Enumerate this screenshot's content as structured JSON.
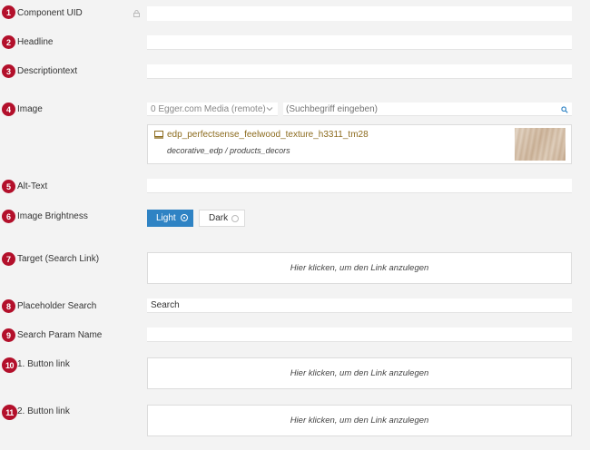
{
  "fields": [
    {
      "num": "1",
      "label": "Component UID"
    },
    {
      "num": "2",
      "label": "Headline"
    },
    {
      "num": "3",
      "label": "Descriptiontext"
    },
    {
      "num": "4",
      "label": "Image"
    },
    {
      "num": "5",
      "label": "Alt-Text"
    },
    {
      "num": "6",
      "label": "Image Brightness"
    },
    {
      "num": "7",
      "label": "Target (Search Link)"
    },
    {
      "num": "8",
      "label": "Placeholder Search"
    },
    {
      "num": "9",
      "label": "Search Param Name"
    },
    {
      "num": "10",
      "label": "1. Button link"
    },
    {
      "num": "11",
      "label": "2. Button link"
    }
  ],
  "image": {
    "source_select": "0 Egger.com Media (remote)",
    "search_placeholder": "(Suchbegriff eingeben)",
    "media_title": "edp_perfectsense_feelwood_texture_h3311_tm28",
    "media_path": "decorative_edp / products_decors"
  },
  "brightness": {
    "light": "Light",
    "dark": "Dark",
    "selected": "Light"
  },
  "link_placeholder": "Hier klicken, um den Link anzulegen",
  "placeholder_search_value": "Search",
  "colors": {
    "badge": "#b3102b",
    "accent": "#2f83c4",
    "media_title": "#8c6b1e"
  }
}
